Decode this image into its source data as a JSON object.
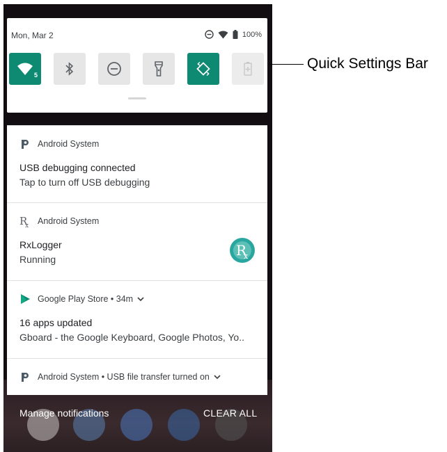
{
  "quick_settings": {
    "date": "Mon, Mar 2",
    "battery_text": "100%",
    "tiles": [
      {
        "name": "wifi",
        "state": "on"
      },
      {
        "name": "bluetooth",
        "state": "off"
      },
      {
        "name": "do-not-disturb",
        "state": "off"
      },
      {
        "name": "flashlight",
        "state": "off"
      },
      {
        "name": "auto-rotate",
        "state": "on"
      },
      {
        "name": "battery-saver",
        "state": "unavailable"
      }
    ],
    "wifi_badge": "5"
  },
  "notifications": [
    {
      "app": "Android System",
      "title": "USB debugging connected",
      "text": "Tap to turn off USB debugging"
    },
    {
      "app": "Android System",
      "title": "RxLogger",
      "text": "Running"
    },
    {
      "app": "Google Play Store • 34m",
      "title": "16 apps updated",
      "text": "Gboard - the Google Keyboard, Google Photos, Yo.."
    },
    {
      "app": "Android System • USB file transfer turned on"
    }
  ],
  "footer": {
    "manage": "Manage notifications",
    "clear": "CLEAR ALL"
  },
  "annotation": {
    "label": "Quick Settings Bar"
  },
  "colors": {
    "accent": "#0e8a72",
    "rx_logo": "#2aa6a0"
  }
}
